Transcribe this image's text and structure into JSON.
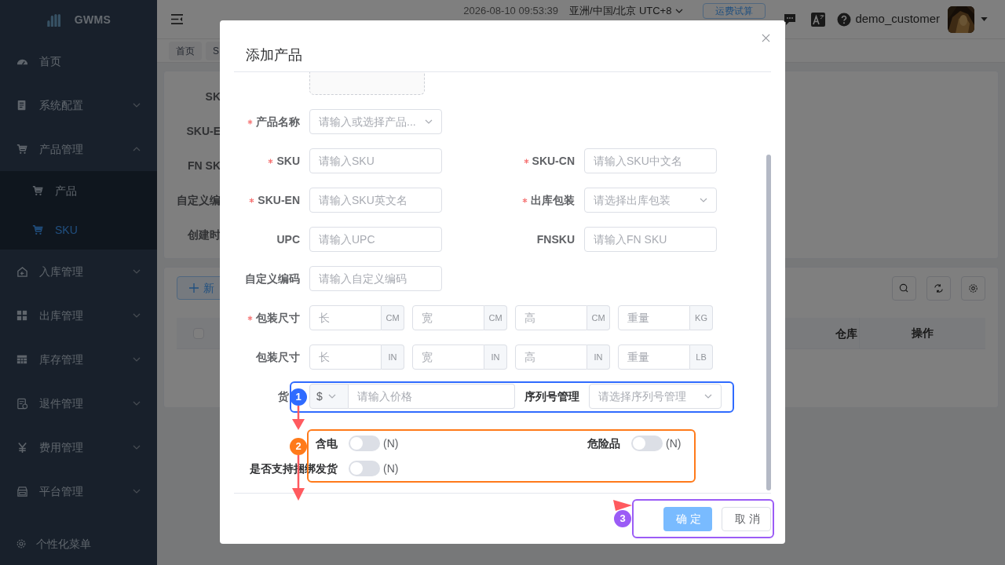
{
  "sidebar": {
    "logo": "GWMS",
    "items": [
      {
        "label": "首页",
        "kind": "link"
      },
      {
        "label": "系统配置",
        "kind": "submenu",
        "expanded": false
      },
      {
        "label": "产品管理",
        "kind": "submenu",
        "expanded": true,
        "children": [
          {
            "label": "产品",
            "selected": false
          },
          {
            "label": "SKU",
            "selected": true
          }
        ]
      },
      {
        "label": "入库管理",
        "kind": "submenu",
        "expanded": false
      },
      {
        "label": "出库管理",
        "kind": "submenu",
        "expanded": false
      },
      {
        "label": "库存管理",
        "kind": "submenu",
        "expanded": false
      },
      {
        "label": "退件管理",
        "kind": "submenu",
        "expanded": false
      },
      {
        "label": "费用管理",
        "kind": "submenu",
        "expanded": false
      },
      {
        "label": "平台管理",
        "kind": "submenu",
        "expanded": false
      }
    ],
    "footer": "个性化菜单"
  },
  "header": {
    "datetime": "2026-08-10 09:53:39",
    "timezone": "亚洲/中国/北京 UTC+8",
    "button": "运费试算",
    "user": "demo_customer"
  },
  "background": {
    "tags": [
      "首页",
      "S"
    ],
    "filter_labels": [
      "SK",
      "SKU-E",
      "FN SK",
      "自定义编",
      "创建时"
    ],
    "add_button": "新",
    "checked": false,
    "table_columns": [
      "仓库",
      "操作"
    ]
  },
  "modal": {
    "title": "添加产品",
    "rows": [
      {
        "kind": "fields",
        "fields": [
          {
            "label": "产品名称",
            "required": true,
            "kind": "select",
            "placeholder": "请输入或选择产品..."
          }
        ]
      },
      {
        "kind": "fields",
        "fields": [
          {
            "label": "SKU",
            "required": true,
            "kind": "input",
            "placeholder": "请输入SKU"
          },
          {
            "label": "SKU-CN",
            "required": true,
            "kind": "input",
            "placeholder": "请输入SKU中文名"
          }
        ]
      },
      {
        "kind": "fields",
        "fields": [
          {
            "label": "SKU-EN",
            "required": true,
            "kind": "input",
            "placeholder": "请输入SKU英文名"
          },
          {
            "label": "出库包装",
            "required": true,
            "kind": "select",
            "placeholder": "请选择出库包装"
          }
        ]
      },
      {
        "kind": "fields",
        "fields": [
          {
            "label": "UPC",
            "required": false,
            "kind": "input",
            "placeholder": "请输入UPC"
          },
          {
            "label": "FNSKU",
            "required": false,
            "kind": "input",
            "placeholder": "请输入FN SKU"
          }
        ]
      },
      {
        "kind": "fields",
        "fields": [
          {
            "label": "自定义编码",
            "required": false,
            "kind": "input",
            "placeholder": "请输入自定义编码"
          }
        ]
      },
      {
        "kind": "dims",
        "label": "包装尺寸",
        "required": true,
        "inputs": [
          {
            "placeholder": "长",
            "unit": "CM"
          },
          {
            "placeholder": "宽",
            "unit": "CM"
          },
          {
            "placeholder": "高",
            "unit": "CM"
          },
          {
            "placeholder": "重量",
            "unit": "KG"
          }
        ]
      },
      {
        "kind": "dims",
        "label": "包装尺寸",
        "required": false,
        "inputs": [
          {
            "placeholder": "长",
            "unit": "IN"
          },
          {
            "placeholder": "宽",
            "unit": "IN"
          },
          {
            "placeholder": "高",
            "unit": "IN"
          },
          {
            "placeholder": "重量",
            "unit": "LB"
          }
        ]
      },
      {
        "kind": "price",
        "label": "货",
        "currency": "$",
        "placeholder": "请输入价格",
        "serial_label": "序列号管理",
        "serial_placeholder": "请选择序列号管理"
      },
      {
        "kind": "switches",
        "switches": [
          {
            "label": "含电",
            "on": false,
            "text": "(N)"
          },
          {
            "label": "危险品",
            "on": false,
            "text": "(N)"
          }
        ]
      },
      {
        "kind": "switches",
        "switches": [
          {
            "label": "是否支持捆绑发货",
            "on": false,
            "text": "(N)"
          }
        ]
      }
    ],
    "buttons": [
      {
        "label": "确 定",
        "kind": "primary"
      },
      {
        "label": "取 消",
        "kind": "default"
      }
    ]
  },
  "annotations": [
    {
      "number": "1",
      "color": "#2f6bff"
    },
    {
      "number": "2",
      "color": "#ff7a1a"
    },
    {
      "number": "3",
      "color": "#9b5cf6"
    }
  ]
}
